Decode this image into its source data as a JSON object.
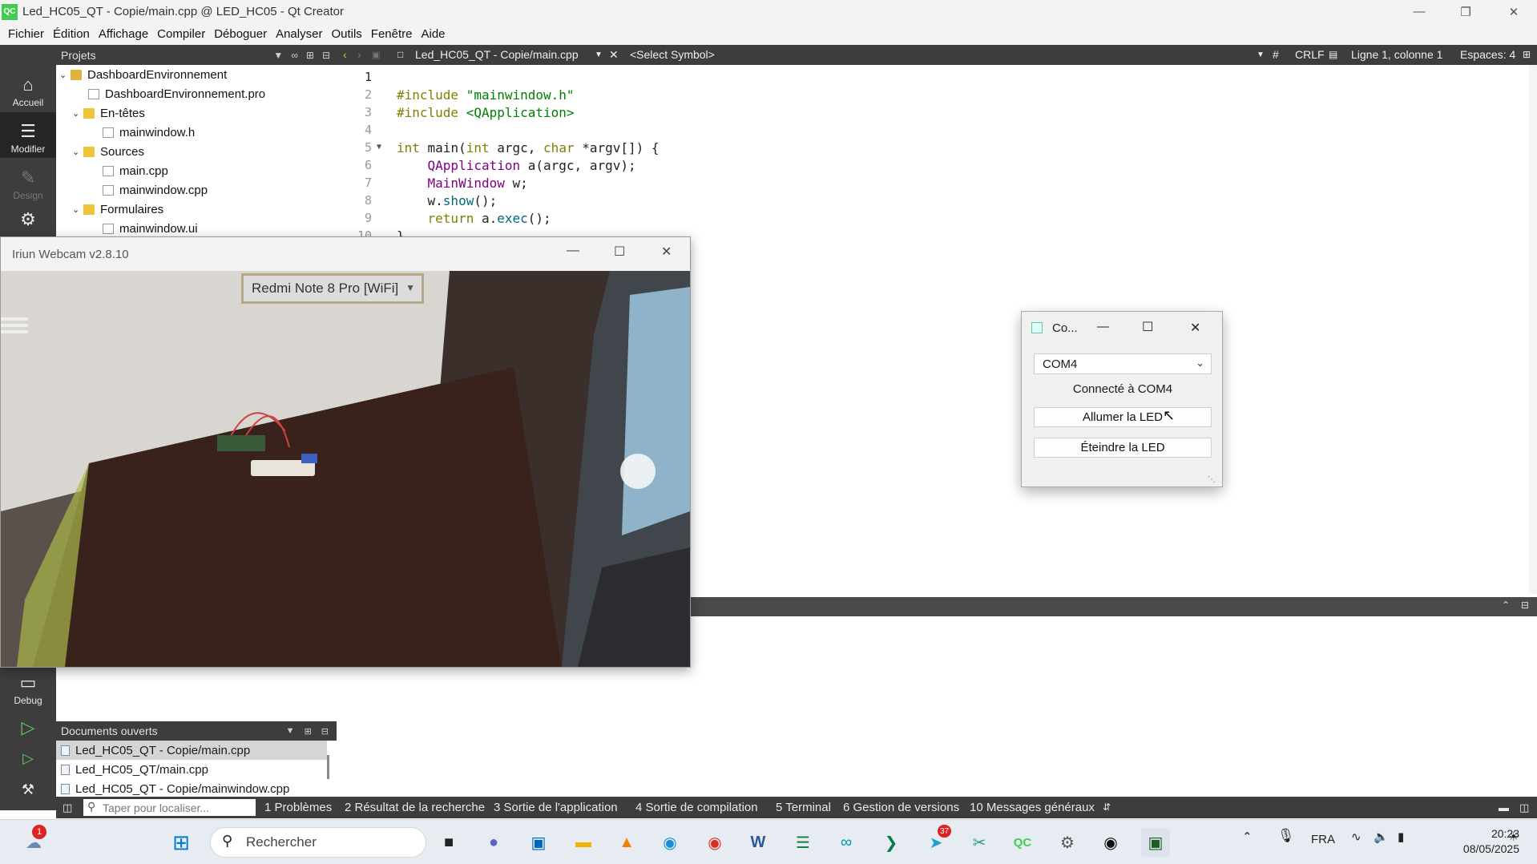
{
  "window": {
    "title": "Led_HC05_QT - Copie/main.cpp @ LED_HC05 - Qt Creator",
    "app_icon": "QC"
  },
  "menu": [
    "Fichier",
    "Édition",
    "Affichage",
    "Compiler",
    "Déboguer",
    "Analyser",
    "Outils",
    "Fenêtre",
    "Aide"
  ],
  "modes": {
    "welcome": "Accueil",
    "edit": "Modifier",
    "design": "Design",
    "debug": "Debug"
  },
  "projects": {
    "header": "Projets",
    "tree": [
      {
        "label": "DashboardEnvironnement",
        "kind": "project"
      },
      {
        "label": "DashboardEnvironnement.pro",
        "kind": "file"
      },
      {
        "label": "En-têtes",
        "kind": "folder"
      },
      {
        "label": "mainwindow.h",
        "kind": "file"
      },
      {
        "label": "Sources",
        "kind": "folder"
      },
      {
        "label": "main.cpp",
        "kind": "file"
      },
      {
        "label": "mainwindow.cpp",
        "kind": "file"
      },
      {
        "label": "Formulaires",
        "kind": "folder"
      },
      {
        "label": "mainwindow.ui",
        "kind": "file"
      }
    ]
  },
  "editor": {
    "file_tab": "Led_HC05_QT - Copie/main.cpp",
    "symbol": "<Select Symbol>",
    "hash": "#",
    "line_ending": "CRLF",
    "position": "Ligne 1, colonne 1",
    "indent": "Espaces: 4",
    "line_numbers": [
      "1",
      "2",
      "3",
      "4",
      "5",
      "6",
      "7",
      "8",
      "9",
      "10"
    ],
    "code": {
      "l2a": "#include ",
      "l2b": "\"mainwindow.h\"",
      "l3a": "#include ",
      "l3b": "<QApplication>",
      "l5a": "int",
      "l5b": " main(",
      "l5c": "int",
      "l5d": " argc, ",
      "l5e": "char",
      "l5f": " *argv[]) {",
      "l6a": "    QApplication",
      "l6b": " a(argc, argv);",
      "l7a": "    MainWindow",
      "l7b": " w;",
      "l8a": "    w.",
      "l8b": "show",
      "l8c": "();",
      "l9a": "    ",
      "l9b": "return",
      "l9c": " a.",
      "l9d": "exec",
      "l9e": "();",
      "l10": "}"
    }
  },
  "open_docs": {
    "header": "Documents ouverts",
    "items": [
      "Led_HC05_QT - Copie/main.cpp",
      "Led_HC05_QT/main.cpp",
      "Led_HC05_QT - Copie/mainwindow.cpp"
    ]
  },
  "status": {
    "locate_placeholder": "Taper pour localiser...",
    "panes": [
      "1 Problèmes",
      "2 Résultat de la recherche",
      "3 Sortie de l'application",
      "4 Sortie de compilation",
      "5 Terminal",
      "6 Gestion de versions",
      "10 Messages généraux"
    ]
  },
  "webcam": {
    "title": "Iriun Webcam v2.8.10",
    "device": "Redmi Note 8 Pro [WiFi]"
  },
  "dialog": {
    "title": "Co...",
    "port": "COM4",
    "status": "Connecté à COM4",
    "on_button": "Allumer la LED",
    "off_button": "Éteindre la LED"
  },
  "taskbar": {
    "search": "Rechercher",
    "notification_badge": "1",
    "telegram_badge": "37",
    "language": "FRA",
    "time": "20:23",
    "date": "08/05/2025"
  }
}
